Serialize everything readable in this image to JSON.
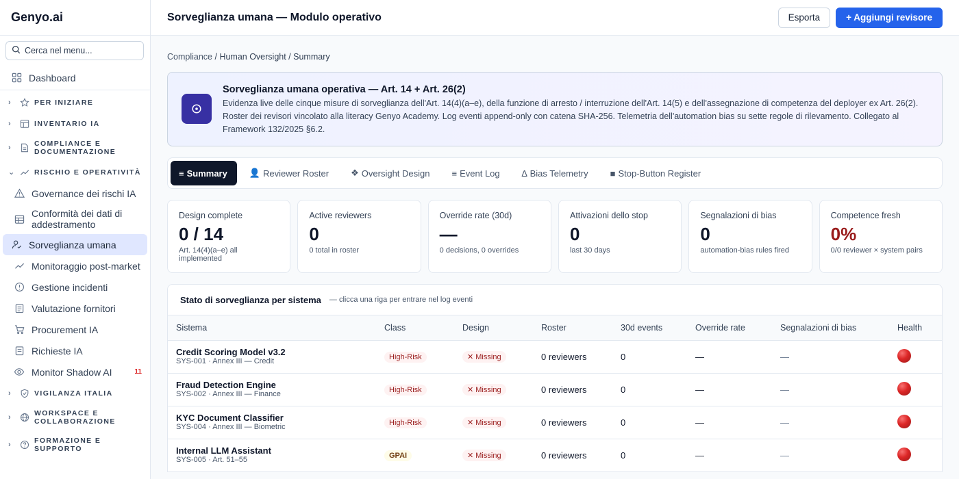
{
  "brand": "Genyo.ai",
  "sidebar": {
    "search_placeholder": "Cerca nel menu...",
    "dashboard": "Dashboard",
    "groups": {
      "per_iniziare": "PER INIZIARE",
      "inventario": "INVENTARIO IA",
      "compliance_1": "COMPLIANCE E",
      "compliance_2": "DOCUMENTAZIONE",
      "rischio": "RISCHIO E OPERATIVITÀ",
      "vigilanza": "VIGILANZA ITALIA",
      "workspace_1": "WORKSPACE E",
      "workspace_2": "COLLABORAZIONE",
      "formazione_1": "FORMAZIONE E",
      "formazione_2": "SUPPORTO"
    },
    "items": {
      "governance": "Governance dei rischi IA",
      "conformita_1": "Conformità dei dati di",
      "conformita_2": "addestramento",
      "sorveglianza": "Sorveglianza umana",
      "monitoraggio": "Monitoraggio post-market",
      "incidenti": "Gestione incidenti",
      "fornitori": "Valutazione fornitori",
      "procurement": "Procurement IA",
      "richieste": "Richieste IA",
      "shadow": "Monitor Shadow AI",
      "shadow_badge": "11"
    }
  },
  "header": {
    "title": "Sorveglianza umana — Modulo operativo",
    "export": "Esporta",
    "add": "+ Aggiungi revisore"
  },
  "breadcrumb": {
    "root": "Compliance",
    "sep1": " / ",
    "mid": "Human Oversight",
    "sep2": " / ",
    "current": "Summary"
  },
  "hero": {
    "title": "Sorveglianza umana operativa — Art. 14 + Art. 26(2)",
    "text": "Evidenza live delle cinque misure di sorveglianza dell'Art. 14(4)(a–e), della funzione di arresto / interruzione dell'Art. 14(5) e dell'assegnazione di competenza del deployer ex Art. 26(2). Roster dei revisori vincolato alla literacy Genyo Academy. Log eventi append-only con catena SHA-256. Telemetria dell'automation bias su sette regole di rilevamento. Collegato al Framework 132/2025 §6.2."
  },
  "tabs": [
    {
      "icon": "≡",
      "label": "Summary"
    },
    {
      "icon": "👤",
      "label": "Reviewer Roster"
    },
    {
      "icon": "❖",
      "label": "Oversight Design"
    },
    {
      "icon": "≡",
      "label": "Event Log"
    },
    {
      "icon": "∆",
      "label": "Bias Telemetry"
    },
    {
      "icon": "■",
      "label": "Stop-Button Register"
    }
  ],
  "kpis": [
    {
      "label": "Design complete",
      "value": "0 / 14",
      "sub": "Art. 14(4)(a–e) all implemented"
    },
    {
      "label": "Active reviewers",
      "value": "0",
      "sub": "0 total in roster"
    },
    {
      "label": "Override rate (30d)",
      "value": "—",
      "sub": "0 decisions, 0 overrides"
    },
    {
      "label": "Attivazioni dello stop",
      "value": "0",
      "sub": "last 30 days"
    },
    {
      "label": "Segnalazioni di bias",
      "value": "0",
      "sub": "automation-bias rules fired"
    },
    {
      "label": "Competence fresh",
      "value": "0%",
      "sub": "0/0 reviewer × system pairs"
    }
  ],
  "table": {
    "title": "Stato di sorveglianza per sistema",
    "hint": "— clicca una riga per entrare nel log eventi",
    "columns": [
      "Sistema",
      "Class",
      "Design",
      "Roster",
      "30d events",
      "Override rate",
      "Segnalazioni di bias",
      "Health"
    ],
    "rows": [
      {
        "name": "Credit Scoring Model v3.2",
        "sub": "SYS-001 · Annex III — Credit",
        "class": "High-Risk",
        "design": "✕ Missing",
        "roster": "0 reviewers",
        "events": "0",
        "override": "—",
        "bias": "—"
      },
      {
        "name": "Fraud Detection Engine",
        "sub": "SYS-002 · Annex III — Finance",
        "class": "High-Risk",
        "design": "✕ Missing",
        "roster": "0 reviewers",
        "events": "0",
        "override": "—",
        "bias": "—"
      },
      {
        "name": "KYC Document Classifier",
        "sub": "SYS-004 · Annex III — Biometric",
        "class": "High-Risk",
        "design": "✕ Missing",
        "roster": "0 reviewers",
        "events": "0",
        "override": "—",
        "bias": "—"
      },
      {
        "name": "Internal LLM Assistant",
        "sub": "SYS-005 · Art. 51–55",
        "class": "GPAI",
        "design": "✕ Missing",
        "roster": "0 reviewers",
        "events": "0",
        "override": "—",
        "bias": "—"
      }
    ]
  }
}
